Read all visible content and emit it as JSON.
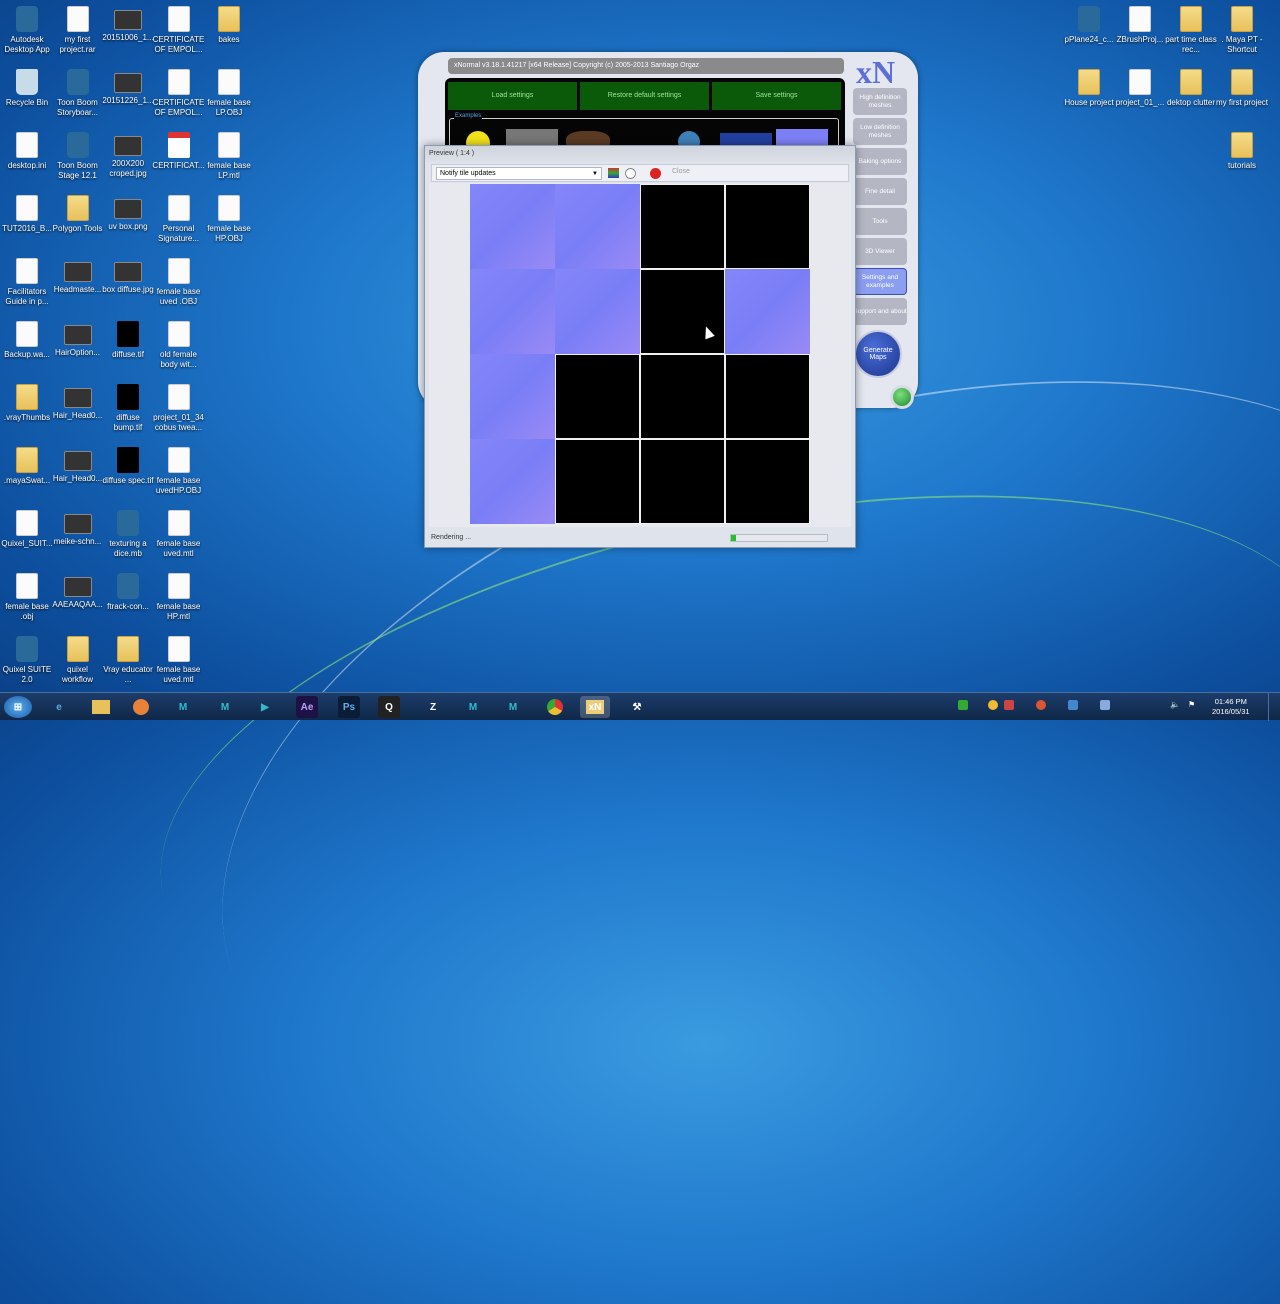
{
  "desktop": {
    "left_columns": [
      [
        "Autodesk Desktop App",
        "Recycle Bin",
        "desktop.ini",
        "TUT2016_B...",
        "Facilitators Guide in p...",
        "Backup.wa...",
        ".vrayThumbs",
        ".mayaSwat...",
        "Quixel_SUIT...",
        "female base .obj",
        "Quixel SUITE 2.0"
      ],
      [
        "my first project.rar",
        "Toon Boom Storyboar...",
        "Toon Boom Stage 12.1",
        "Polygon Tools",
        "Headmaste...",
        "HairOption...",
        "Hair_Head0...",
        "Hair_Head0...",
        "meike-schn...",
        "AAEAAQAA...",
        "quixel workflow"
      ],
      [
        "20151006_1...",
        "20151226_1...",
        "200X200 croped.jpg",
        "uv box.png",
        "box diffuse.jpg",
        "diffuse.tif",
        "diffuse bump.tif",
        "diffuse spec.tif",
        "texturing a dice.mb",
        "ftrack-con...",
        "Vray educator ..."
      ],
      [
        "CERTIFICATE OF EMPOL...",
        "CERTIFICATE OF EMPOL...",
        "CERTIFICAT...",
        "Personal Signature...",
        "female base uved .OBJ",
        "old female body wit...",
        "project_01_34 cobus twea...",
        "female base uvedHP.OBJ",
        "female base uved.mtl",
        "female base HP.mtl",
        "female base uved.mtl"
      ],
      [
        "bakes",
        "female base LP.OBJ",
        "female base LP.mtl",
        "female base HP.OBJ"
      ]
    ],
    "right_rows": [
      [
        "pPlane24_c...",
        "ZBrushProj...",
        "part time class rec...",
        ". Maya PT - Shortcut"
      ],
      [
        "House project",
        "project_01_...",
        "dektop clutter",
        "my first project"
      ],
      [
        "",
        "",
        "",
        "tutorials"
      ]
    ]
  },
  "xnormal": {
    "title": "xNormal v3.18.1.41217 [x64 Release] Copyright (c) 2005-2013  Santiago Orgaz",
    "logo": "xN",
    "load": "Load settings",
    "restore": "Restore default settings",
    "save": "Save settings",
    "examples": "Examples",
    "sidebar": [
      "High definition meshes",
      "Low definition meshes",
      "Baking options",
      "Fine detail",
      "Tools",
      "3D Viewer",
      "Settings and examples",
      "Support and about"
    ],
    "generate": "Generate Maps"
  },
  "preview": {
    "title": "Preview ( 1:4 )",
    "dropdown": "Notify tile updates",
    "close": "Close",
    "status": "Rendering ...",
    "progress": 0.05,
    "tiles": [
      "n",
      "n",
      "b",
      "b",
      "n",
      "n",
      "b",
      "n",
      "n",
      "b",
      "b",
      "b",
      "n",
      "b",
      "b",
      "b"
    ]
  },
  "taskbar": {
    "ae": "Ae",
    "ps": "Ps",
    "xn": "xN",
    "time": "01:46 PM",
    "date": "2016/05/31"
  },
  "colors": {
    "accent": "#1f78cc",
    "normal_map": "#8486f8",
    "green_button": "#0a5a0a"
  }
}
